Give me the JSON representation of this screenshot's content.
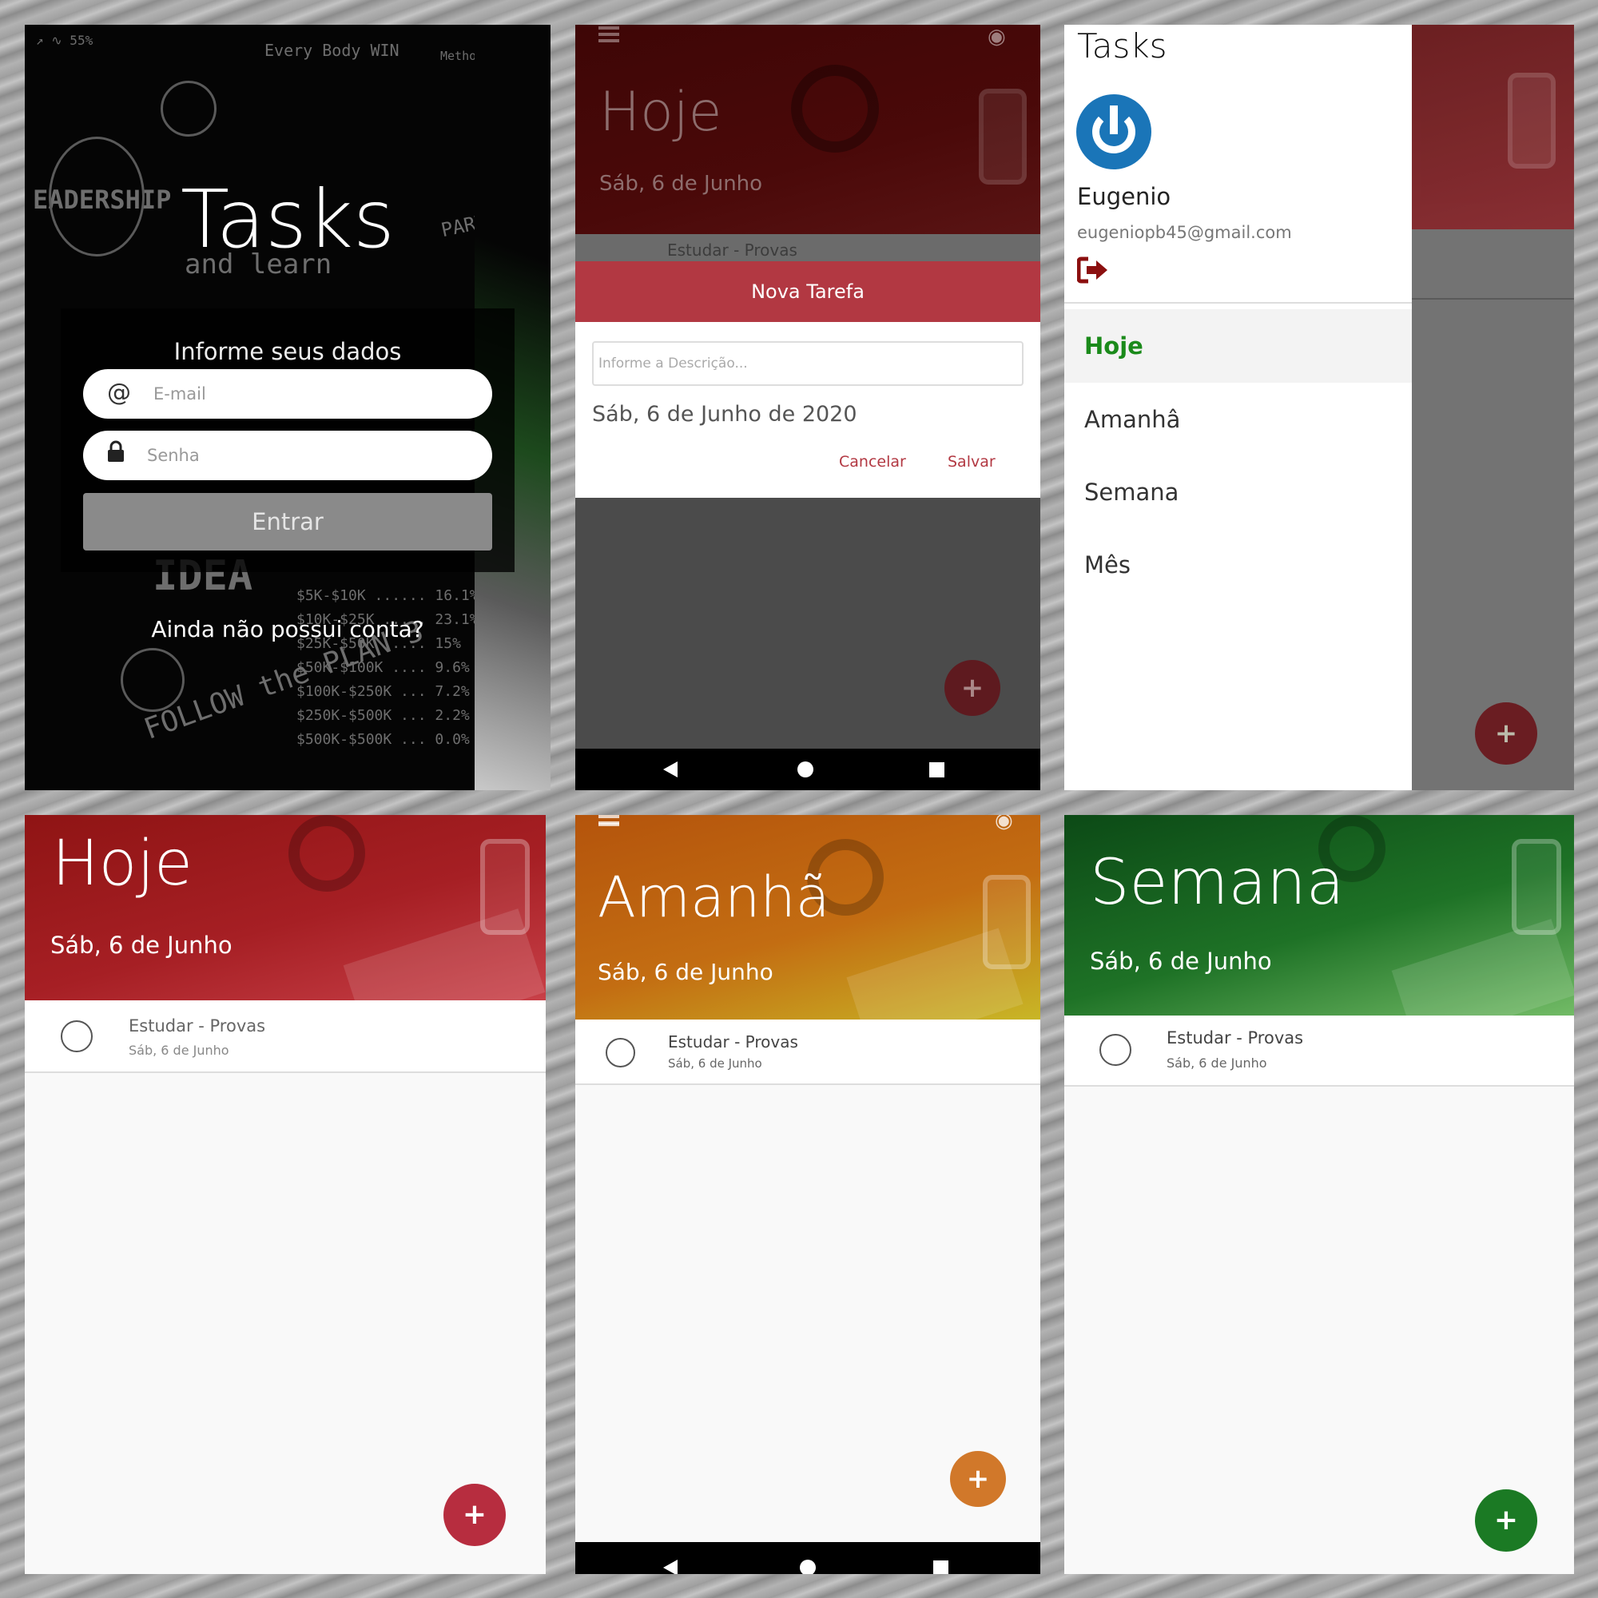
{
  "login": {
    "title": "Tasks",
    "subtitle": "Informe seus dados",
    "email_icon": "@",
    "email_placeholder": "E-mail",
    "password_placeholder": "Senha",
    "submit_label": "Entrar",
    "signup_link": "Ainda não possui conta?"
  },
  "dialog_screen": {
    "header_title": "Hoje",
    "header_date": "Sáb, 6 de Junho",
    "task_desc": "Estudar - Provas",
    "dialog": {
      "title": "Nova Tarefa",
      "input_placeholder": "Informe a Descrição...",
      "date": "Sáb, 6 de Junho de 2020",
      "cancel_label": "Cancelar",
      "save_label": "Salvar"
    },
    "fab_icon": "+"
  },
  "drawer_screen": {
    "title": "Tasks",
    "user_name": "Eugenio",
    "user_email": "eugeniopb45@gmail.com",
    "logout_icon": "sign-out-icon",
    "menu": [
      {
        "label": "Hoje",
        "active": true
      },
      {
        "label": "Amanhâ",
        "active": false
      },
      {
        "label": "Semana",
        "active": false
      },
      {
        "label": "Mês",
        "active": false
      }
    ],
    "active_color": "#1a8a1a",
    "fab_icon": "+"
  },
  "today_screen": {
    "title": "Hoje",
    "date": "Sáb, 6 de Junho",
    "task": {
      "desc": "Estudar - Provas",
      "date": "Sáb, 6 de Junho"
    },
    "fab_icon": "+",
    "accent": "#b72d3f"
  },
  "tomorrow_screen": {
    "title": "Amanhã",
    "date": "Sáb, 6 de Junho",
    "task": {
      "desc": "Estudar - Provas",
      "date": "Sáb, 6 de Junho"
    },
    "fab_icon": "+",
    "accent": "#d1782a"
  },
  "week_screen": {
    "title": "Semana",
    "date": "Sáb, 6 de Junho",
    "task": {
      "desc": "Estudar - Provas",
      "date": "Sáb, 6 de Junho"
    },
    "fab_icon": "+",
    "accent": "#1b7a24"
  }
}
